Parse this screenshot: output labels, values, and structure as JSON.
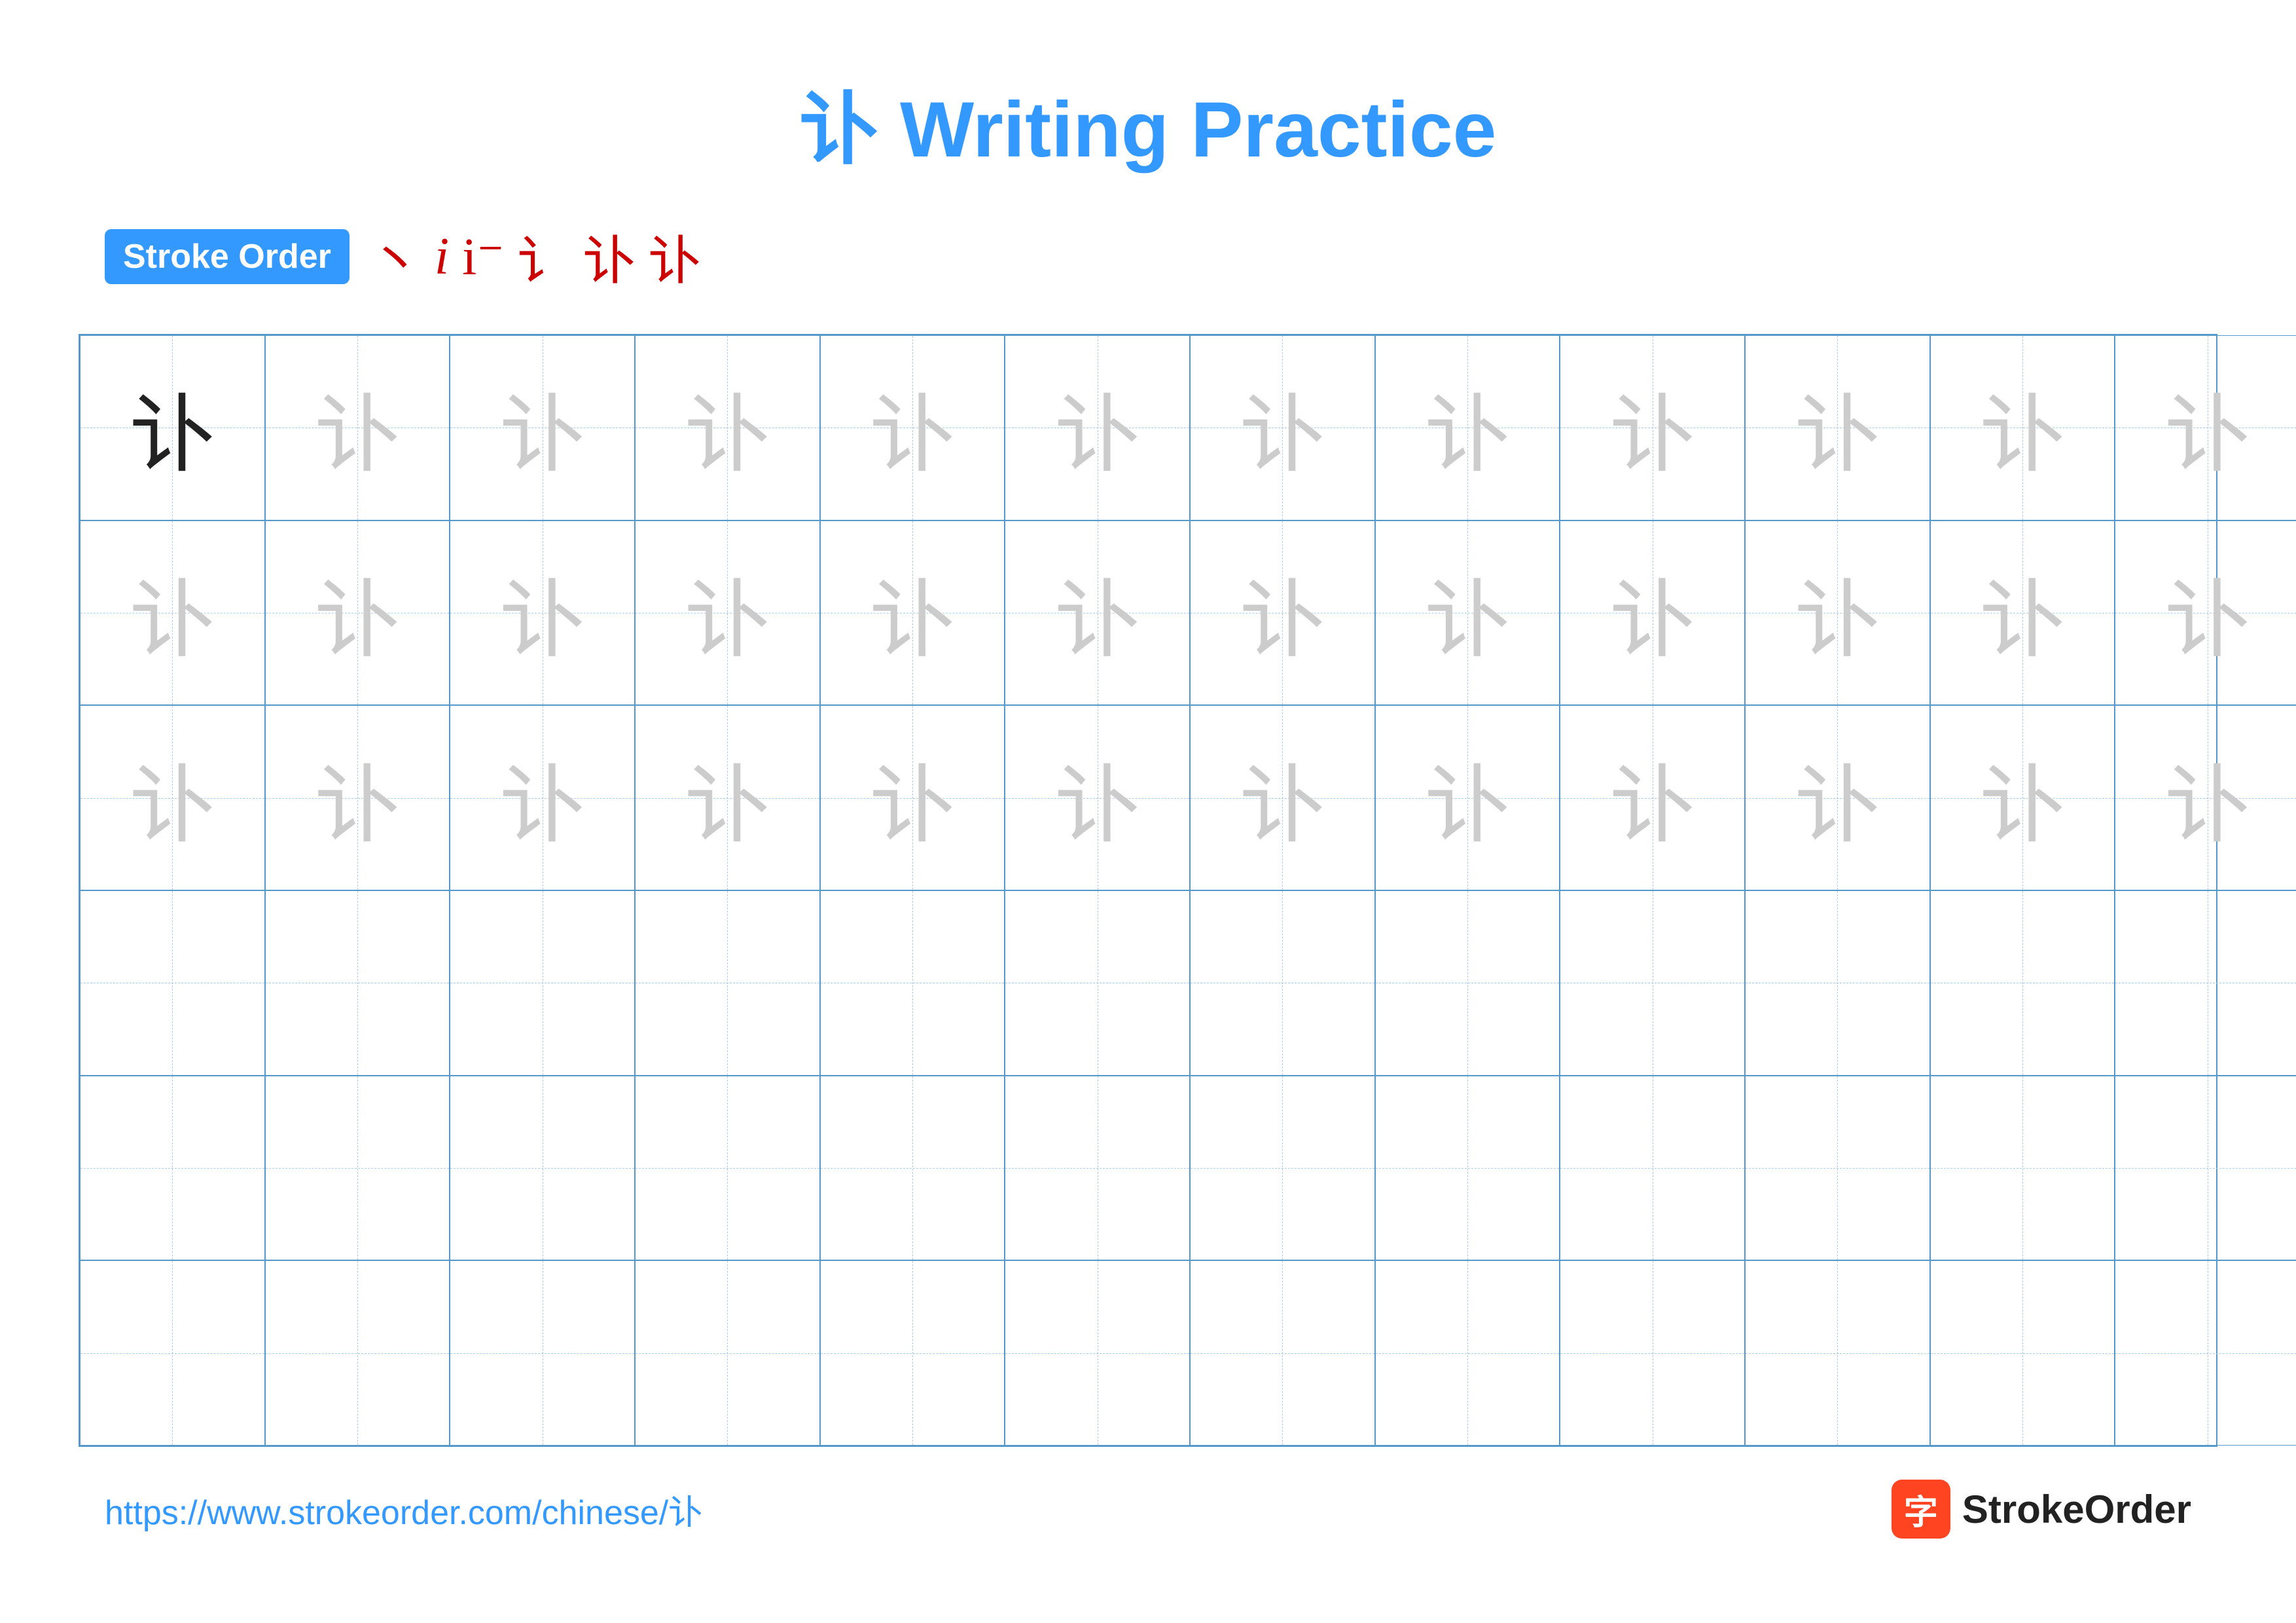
{
  "title": "讣 Writing Practice",
  "stroke_order": {
    "label": "Stroke Order",
    "strokes": [
      "丶",
      "i",
      "i⁻",
      "讠",
      "讣",
      "讣"
    ]
  },
  "character": "讣",
  "grid": {
    "cols": 13,
    "rows": 6,
    "row_types": [
      "dark_then_light",
      "light",
      "light",
      "empty",
      "empty",
      "empty"
    ]
  },
  "footer": {
    "url": "https://www.strokeorder.com/chinese/讣",
    "logo_icon": "字",
    "logo_text": "StrokeOrder"
  }
}
